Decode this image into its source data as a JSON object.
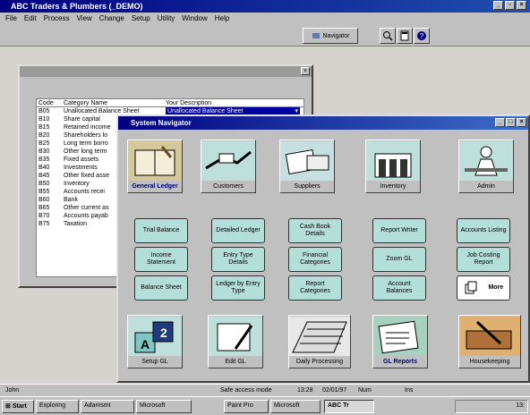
{
  "app": {
    "title": "ABC Traders & Plumbers (_DEMO)"
  },
  "menu": [
    "File",
    "Edit",
    "Process",
    "View",
    "Change",
    "Setup",
    "Utility",
    "Window",
    "Help"
  ],
  "toolbar": {
    "navigator_label": "Navigator"
  },
  "category_window": {
    "columns": [
      "Code",
      "Category Name",
      "Your Description"
    ],
    "selected_description": "Unallocated Balance Sheet",
    "rows": [
      [
        "B05",
        "Unallocated Balance Sheet"
      ],
      [
        "B10",
        "Share capital"
      ],
      [
        "B15",
        "Retained income"
      ],
      [
        "B20",
        "Shareholders lo"
      ],
      [
        "B25",
        "Long term borro"
      ],
      [
        "B30",
        "Other long term"
      ],
      [
        "B35",
        "Fixed assets"
      ],
      [
        "B40",
        "Investments"
      ],
      [
        "B45",
        "Other fixed asse"
      ],
      [
        "B50",
        "Inventory"
      ],
      [
        "B55",
        "Accounts recei"
      ],
      [
        "B60",
        "Bank"
      ],
      [
        "B65",
        "Other current as"
      ],
      [
        "B70",
        "Accounts payab"
      ],
      [
        "B75",
        "Taxation"
      ]
    ]
  },
  "navigator": {
    "title": "System Navigator",
    "top_modules": [
      "General Ledger",
      "Customers",
      "Suppliers",
      "Inventory",
      "Admin"
    ],
    "buttons": [
      [
        "Trial Balance",
        "Detailed Ledger",
        "Cash Book Details",
        "Report Writer",
        "Accounts Listing"
      ],
      [
        "Income Statement",
        "Entry Type Details",
        "Financial Categories",
        "Zoom GL",
        "Job Costing Report"
      ],
      [
        "Balance Sheet",
        "Ledger by Entry Type",
        "Report Categories",
        "Account Balances"
      ]
    ],
    "more_label": "More",
    "bottom_modules": [
      "Setup GL",
      "Edit GL",
      "Daily Processing",
      "GL Reports",
      "Housekeeping"
    ]
  },
  "status": {
    "user": "John",
    "mode": "Safe access mode",
    "time": "13:28",
    "date": "02/01/97",
    "num": "Num",
    "ins": "Ins"
  },
  "taskbar": {
    "start": "Start",
    "tasks": [
      "Exploring",
      "Adamsmt",
      "Microsoft",
      "Paint Pro",
      "Microsoft",
      "ABC Tr"
    ],
    "tray_time": "13:"
  }
}
